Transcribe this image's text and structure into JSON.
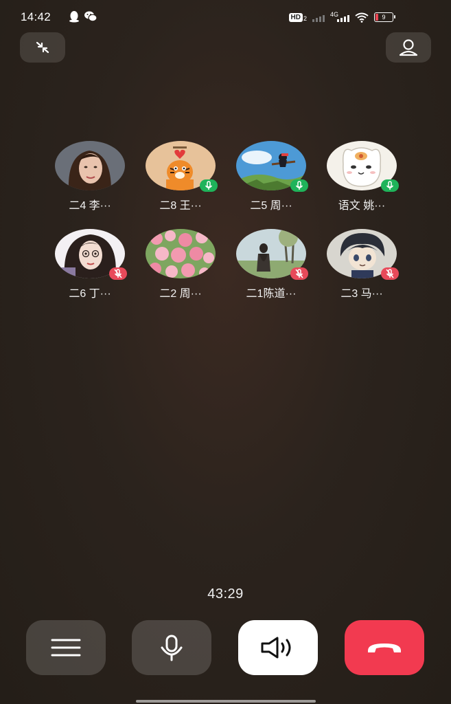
{
  "status_bar": {
    "time": "14:42",
    "battery": "9",
    "hd_label": "HD",
    "hd_sub": "2",
    "network": "4G",
    "left_icons": [
      "qq-penguin-icon",
      "wechat-icon"
    ],
    "right_icons": [
      "hd-icon",
      "signal-weak-icon",
      "signal-4g-icon",
      "wifi-icon",
      "battery-low-icon"
    ]
  },
  "top_bar": {
    "left_icon": "minimize-arrows-icon",
    "right_icon": "person-icon"
  },
  "participants": [
    {
      "name": "二4 李···",
      "mic": "none"
    },
    {
      "name": "二8 王···",
      "mic": "on"
    },
    {
      "name": "二5 周···",
      "mic": "on"
    },
    {
      "name": "语文 姚···",
      "mic": "on"
    },
    {
      "name": "二6 丁···",
      "mic": "off"
    },
    {
      "name": "二2 周···",
      "mic": "none"
    },
    {
      "name": "二1陈道···",
      "mic": "off"
    },
    {
      "name": "二3 马···",
      "mic": "off"
    }
  ],
  "call": {
    "duration": "43:29"
  },
  "controls": [
    {
      "icon": "menu-icon",
      "color": "#ffffff"
    },
    {
      "icon": "microphone-icon",
      "color": "#ffffff"
    },
    {
      "icon": "speaker-icon",
      "color": "#111111"
    },
    {
      "icon": "hang-up-phone-icon",
      "color": "#f23a50"
    }
  ],
  "colors": {
    "mic_on": "#1fb35a",
    "mic_off": "#e84a5a",
    "hang_up": "#f23a50",
    "background": "#2b231d"
  }
}
